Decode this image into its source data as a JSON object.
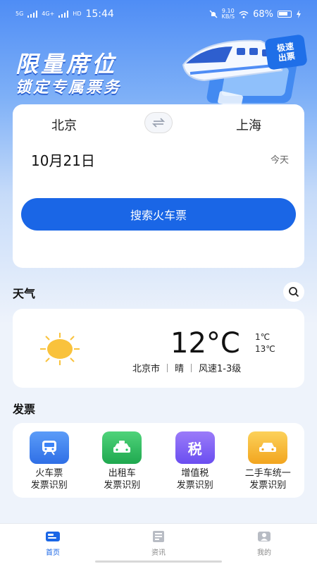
{
  "status_bar": {
    "signal1": "5G",
    "signal2": "4G+",
    "hd": "HD",
    "time": "15:44",
    "speed": "9.10\nKB/S",
    "battery": "68%"
  },
  "banner": {
    "title": "限量席位",
    "subtitle": "锁定专属票务",
    "badge": "极速\n出票"
  },
  "ticket": {
    "from": "北京",
    "to": "上海",
    "date": "10月21日",
    "day": "今天",
    "search_label": "搜索火车票",
    "swap_icon": "swap-icon"
  },
  "weather": {
    "section_title": "天气",
    "temperature": "12°C",
    "high": "1℃",
    "low": "13℃",
    "city": "北京市",
    "condition": "晴",
    "wind": "风速1-3级"
  },
  "invoice": {
    "section_title": "发票",
    "items": [
      {
        "label": "火车票\n发票识别",
        "icon": "train-icon",
        "color": "#3b82f6"
      },
      {
        "label": "出租车\n发票识别",
        "icon": "taxi-icon",
        "color": "#22c55e"
      },
      {
        "label": "增值税\n发票识别",
        "icon": "tax-icon",
        "glyph": "税",
        "color": "#7c5cf5"
      },
      {
        "label": "二手车统一\n发票识别",
        "icon": "car-icon",
        "color": "#f7b733"
      }
    ]
  },
  "tabs": [
    {
      "label": "首页",
      "icon": "ticket-icon",
      "active": true
    },
    {
      "label": "资讯",
      "icon": "news-icon",
      "active": false
    },
    {
      "label": "我的",
      "icon": "profile-icon",
      "active": false
    }
  ],
  "colors": {
    "primary": "#1a66e6",
    "page_bg": "#eef3fb",
    "sun": "#f9c23c"
  }
}
